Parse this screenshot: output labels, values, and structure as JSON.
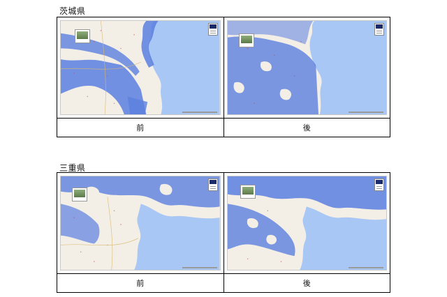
{
  "sections": [
    {
      "title": "茨城県",
      "before_label": "前",
      "after_label": "後"
    },
    {
      "title": "三重県",
      "before_label": "前",
      "after_label": "後"
    }
  ],
  "colors": {
    "coverage": "#5b7fe0",
    "sea": "#a9c7f5",
    "land": "#f3efe6"
  }
}
